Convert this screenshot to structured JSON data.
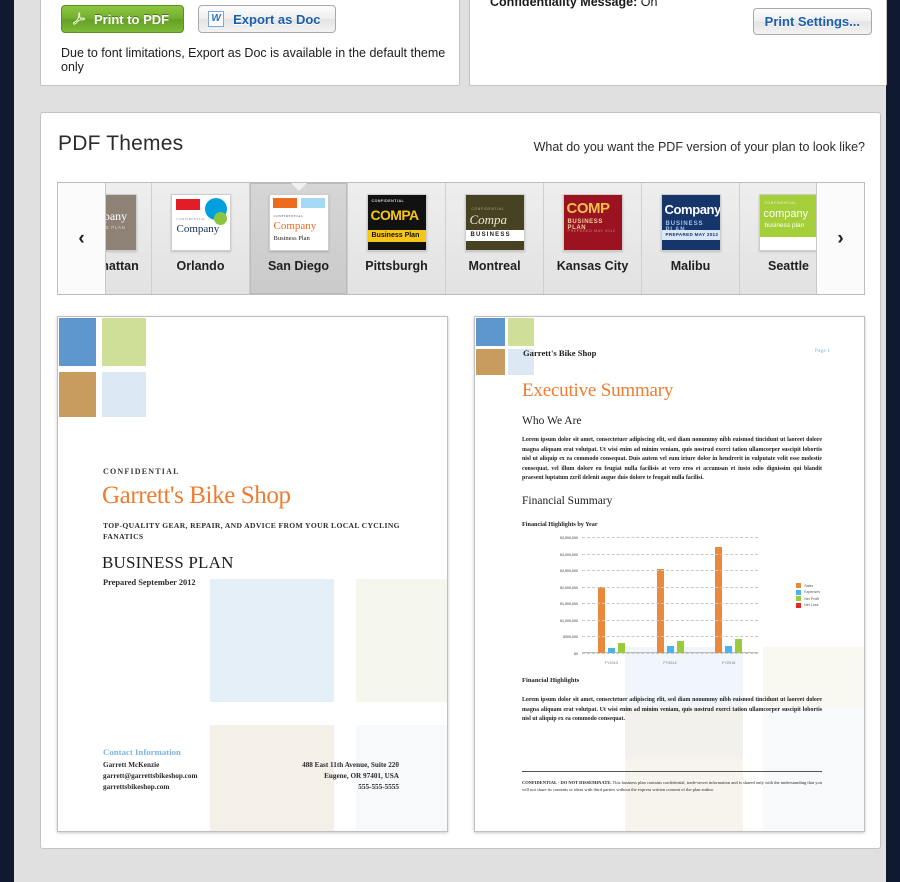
{
  "toolbar": {
    "print_pdf_label": "Print to PDF",
    "export_doc_label": "Export as Doc",
    "note": "Due to font limitations, Export as Doc is available in the default theme only",
    "confidentiality_label": "Confidentiality Message:",
    "confidentiality_value": "On",
    "print_settings_label": "Print Settings..."
  },
  "themes": {
    "title": "PDF Themes",
    "subtitle": "What do you want the PDF version of your plan to look like?",
    "prev_label": "‹",
    "next_label": "›",
    "selected": "San Diego",
    "items": [
      {
        "label": "Manhattan",
        "clipped": true
      },
      {
        "label": "Orlando",
        "clipped": false
      },
      {
        "label": "San Diego",
        "clipped": false
      },
      {
        "label": "Pittsburgh",
        "clipped": false
      },
      {
        "label": "Montreal",
        "clipped": false
      },
      {
        "label": "Kansas City",
        "clipped": false
      },
      {
        "label": "Malibu",
        "clipped": false
      },
      {
        "label": "Seattle",
        "clipped": false
      }
    ],
    "thumb_text": {
      "confidential": "CONFIDENTIAL",
      "company": "Company",
      "business_plan": "Business Plan",
      "business": "BUSINESS",
      "prepared": "PREPARED MAY 2012",
      "company_lower": "company",
      "business_plan_lower": "business plan",
      "compa": "COMPA",
      "comp_script": "Compa",
      "comp_caps": "COMP",
      "bp_caps": "BUSINESS PLAN"
    }
  },
  "cover": {
    "confidential": "CONFIDENTIAL",
    "title": "Garrett's Bike Shop",
    "tagline": "TOP-QUALITY GEAR, REPAIR, AND ADVICE FROM YOUR LOCAL CYCLING FANATICS",
    "doc_type": "BUSINESS PLAN",
    "prepared": "Prepared September 2012",
    "contact_heading": "Contact Information",
    "contact_name": "Garrett McKenzie",
    "contact_email": "garrett@garrettsbikeshop.com",
    "contact_site": "garrettsbikeshop.com",
    "address_line1": "488 East 11th Avenue, Suite 220",
    "address_line2": "Eugene, OR 97401, USA",
    "address_phone": "555-555-5555"
  },
  "summary_page": {
    "header": "Garrett's Bike Shop",
    "page_number": "Page 1",
    "title": "Executive Summary",
    "section_1_heading": "Who We Are",
    "section_1_body": "Lorem ipsum dolor sit amet, consectetuer adipiscing elit, sed diam nonummy nibh euismod tincidunt ut laoreet dolore magna aliquam erat volutpat. Ut wisi enim ad minim veniam, quis nostrud exerci tation ullamcorper suscipit lobortis nisl ut aliquip ex ea commodo consequat. Duis autem vel eum iriure dolor in hendrerit in vulputate velit esse molestie consequat, vel illum dolore eu feugiat nulla facilisis at vero eros et accumsan et iusto odio dignissim qui blandit praesent luptatum zzril delenit augue duis dolore te feugait nulla facilisi.",
    "section_2_heading": "Financial Summary",
    "section_3_heading": "Financial Highlights",
    "section_3_body": "Lorem ipsum dolor sit amet, consectetuer adipiscing elit, sed diam nonummy nibh euismod tincidunt ut laoreet dolore magna aliquam erat volutpat. Ut wisi enim ad minim veniam, quis nostrud exerci tation ullamcorper suscipit lobortis nisl ut aliquip ex ea commodo consequat.",
    "footer_bold": "CONFIDENTIAL - DO NOT DISSEMINATE.",
    "footer_text": " This business plan contains confidential, trade-secret information and is shared only with the understanding that you will not share its contents or ideas with third parties without the express written consent of the plan author."
  },
  "chart_data": {
    "type": "bar",
    "title": "Financial Highlights by Year",
    "categories": [
      "FY2013",
      "FY2014",
      "FY2015"
    ],
    "series": [
      {
        "name": "Sales",
        "color": "#e8893c",
        "values": [
          2000000,
          2550000,
          3200000
        ]
      },
      {
        "name": "Expenses",
        "color": "#4bb3e8",
        "values": [
          160000,
          210000,
          215000
        ]
      },
      {
        "name": "Net Profit",
        "color": "#9bcb3b",
        "values": [
          290000,
          350000,
          430000
        ]
      },
      {
        "name": "Net Loss",
        "color": "#e02b20",
        "values": [
          0,
          0,
          0
        ]
      }
    ],
    "ylim": [
      0,
      3500000
    ],
    "yticks": [
      0,
      500000,
      1000000,
      1500000,
      2000000,
      2500000,
      3000000,
      3500000
    ],
    "ytick_labels": [
      "$0",
      "$500,000",
      "$1,000,000",
      "$1,500,000",
      "$2,000,000",
      "$2,500,000",
      "$3,000,000",
      "$3,500,000"
    ],
    "xlabel": "",
    "ylabel": "",
    "grid": true,
    "legend_position": "right"
  },
  "colors": {
    "accent_orange": "#ec7d31",
    "brand_blue": "#5e97cd",
    "brand_green": "#cfdf98",
    "brand_tan": "#c89b5f",
    "brand_ltblue": "#dce8f4",
    "link_blue": "#1a5fa8",
    "pdf_green": "#72ae2e"
  }
}
